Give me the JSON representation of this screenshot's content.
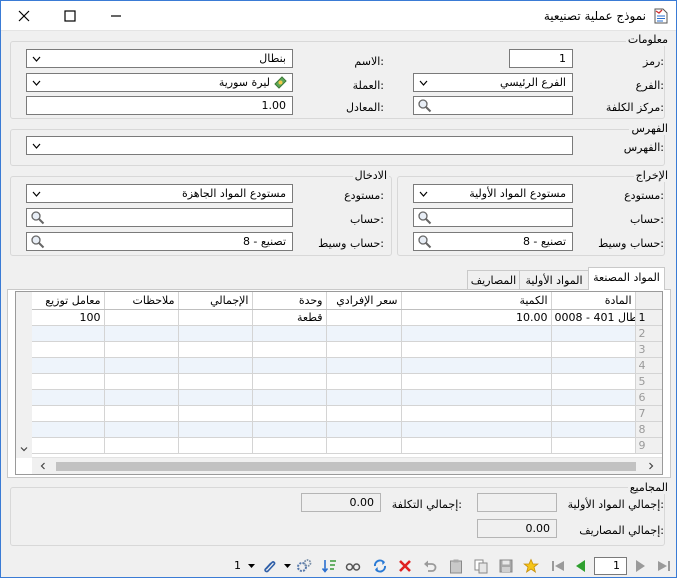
{
  "window": {
    "title": "نموذج عملية تصنيعية"
  },
  "info": {
    "group_label": "معلومات",
    "code_label": "رمز:",
    "code_value": "1",
    "name_label": "الاسم:",
    "name_value": "بنطال",
    "branch_label": "الفرع:",
    "branch_value": "الفرع الرئيسي",
    "currency_label": "العملة:",
    "currency_value": "ليرة سورية",
    "cost_center_label": "مركز الكلفة:",
    "cost_center_value": "",
    "rate_label": "المعادل:",
    "rate_value": "1.00"
  },
  "index": {
    "group_label": "الفهرس",
    "index_label": "الفهرس:",
    "index_value": ""
  },
  "output": {
    "group_label": "الإخراج",
    "warehouse_label": "مستودع:",
    "warehouse_value": "مستودع المواد الأولية",
    "account_label": "حساب:",
    "account_value": "",
    "intermediate_label": "حساب وسيط:",
    "intermediate_value": "8 - تصنيع"
  },
  "input": {
    "group_label": "الادخال",
    "warehouse_label": "مستودع:",
    "warehouse_value": "مستودع المواد الجاهزة",
    "account_label": "حساب:",
    "account_value": "",
    "intermediate_label": "حساب وسيط:",
    "intermediate_value": "8 - تصنيع"
  },
  "tabs": [
    {
      "label": "المواد المصنعة"
    },
    {
      "label": "المواد الأولية"
    },
    {
      "label": "المصاريف"
    }
  ],
  "grid": {
    "columns": [
      "المادة",
      "الكمية",
      "سعر الإفرادي",
      "وحدة",
      "الإجمالي",
      "ملاحظات",
      "معامل توزيع"
    ],
    "rows": [
      {
        "num": "1",
        "material": "0008 - بنطال 401",
        "qty": "10.00",
        "price": "",
        "unit": "قطعة",
        "total": "",
        "notes": "",
        "factor": "100"
      },
      {
        "num": "2"
      },
      {
        "num": "3"
      },
      {
        "num": "4"
      },
      {
        "num": "5"
      },
      {
        "num": "6"
      },
      {
        "num": "7"
      },
      {
        "num": "8"
      },
      {
        "num": "9"
      }
    ]
  },
  "totals": {
    "group_label": "المجاميع",
    "raw_total_label": "إجمالي المواد الأولية:",
    "raw_total_value": "",
    "cost_total_label": "إجمالي التكلفة:",
    "cost_total_value": "0.00",
    "expenses_total_label": "إجمالي المصاريف:",
    "expenses_total_value": "0.00"
  },
  "toolbar": {
    "record_number": "1",
    "page_value": "1"
  }
}
